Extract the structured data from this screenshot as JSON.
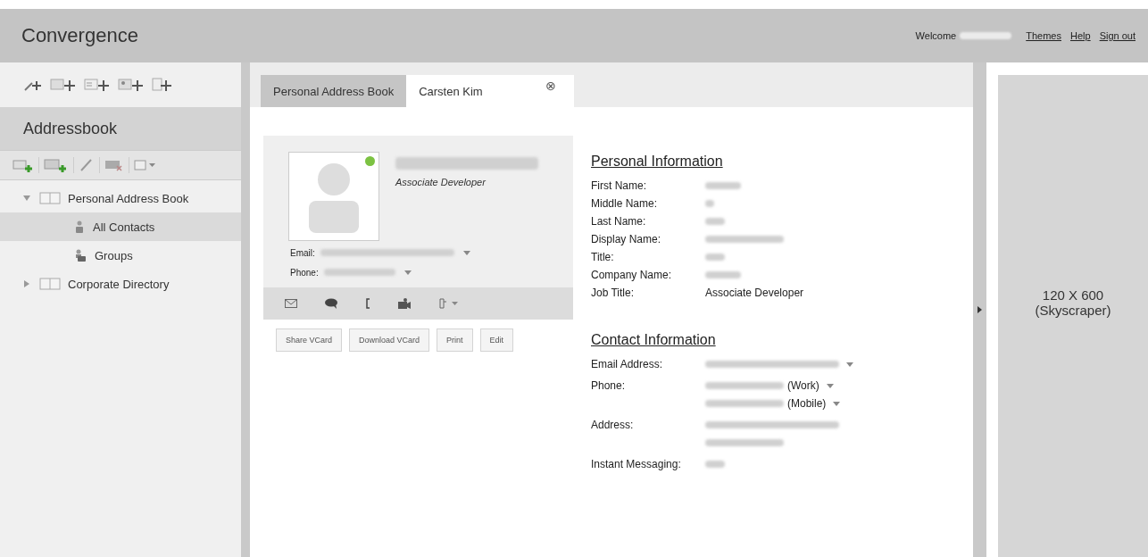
{
  "header": {
    "title": "Convergence",
    "welcome": "Welcome",
    "links": [
      "Themes",
      "Help",
      "Sign out"
    ]
  },
  "sidebar": {
    "title": "Addressbook",
    "tree": [
      {
        "label": "Personal Address Book",
        "expanded": true,
        "selected": false,
        "children": [
          {
            "label": "All Contacts",
            "kind": "contact",
            "selected": true
          },
          {
            "label": "Groups",
            "kind": "group",
            "selected": false
          }
        ]
      },
      {
        "label": "Corporate Directory",
        "expanded": false,
        "selected": false
      }
    ]
  },
  "tabs": [
    {
      "label": "Personal Address Book",
      "selected": false,
      "closable": false
    },
    {
      "label": "Carsten Kim",
      "selected": true,
      "closable": true
    }
  ],
  "close_glyph": "⊗",
  "card": {
    "online": true,
    "job": "Associate Developer",
    "email_label": "Email:",
    "phone_label": "Phone:",
    "buttons": [
      "Share VCard",
      "Download VCard",
      "Print",
      "Edit"
    ]
  },
  "personal": {
    "heading": "Personal Information",
    "rows": [
      {
        "label": "First Name:"
      },
      {
        "label": "Middle Name:"
      },
      {
        "label": "Last Name:"
      },
      {
        "label": "Display Name:"
      },
      {
        "label": "Title:"
      },
      {
        "label": "Company Name:"
      },
      {
        "label": "Job Title:",
        "value": "Associate Developer"
      }
    ]
  },
  "contact": {
    "heading": "Contact Information",
    "rows": [
      {
        "label": "Email Address:",
        "lines": [
          {
            "dropdown": true
          }
        ]
      },
      {
        "label": "Phone:",
        "lines": [
          {
            "suffix": "(Work)",
            "dropdown": true
          },
          {
            "suffix": "(Mobile)",
            "dropdown": true
          }
        ]
      },
      {
        "label": "Address:",
        "lines": [
          {
            "dropdown": false
          },
          {
            "dropdown": false
          }
        ]
      },
      {
        "label": "Instant Messaging:",
        "lines": [
          {
            "dropdown": false
          }
        ]
      }
    ]
  },
  "ad": {
    "lines": [
      "120 X 600",
      "(Skyscraper)"
    ]
  }
}
